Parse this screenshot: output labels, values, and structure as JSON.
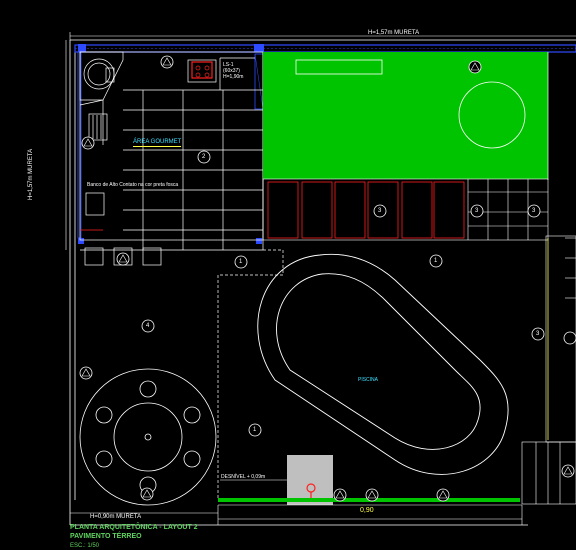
{
  "drawing": {
    "top_dimension": "H=1,57m  MURETA",
    "left_dimension": "H=1,57m  MURETA",
    "bottom_dimension": "H=0,90m  MURETA",
    "bottom_scale_text": "0,90",
    "level_note": "DESNÍVEL + 0,09m",
    "pool_label": "PISCINA",
    "bbq_label": "ÁREA GOURMET",
    "kitchen_tags": [
      "LS-1",
      "(60x37)",
      "H=1,90m"
    ],
    "bench_note": "Banco de Alto Contato na cor preta fosca",
    "callouts_circle": [
      "1",
      "1",
      "1",
      "2",
      "3",
      "3",
      "3",
      "4",
      "3"
    ],
    "callouts_triangle": [
      "7",
      "7",
      "4",
      "7",
      "7",
      "3",
      "3",
      "7",
      "7"
    ],
    "colors": {
      "lawn": "#00c400",
      "wall_blue": "#2f4bff",
      "line": "#ffffff",
      "red": "#ff2020",
      "title_green": "#5fd35f",
      "dim_yellow": "#ffff40",
      "cyan": "#40e0ff"
    }
  },
  "title_block": {
    "line1": "PLANTA ARQUITETÔNICA - LAYOUT 2",
    "line2": "PAVIMENTO TÉRREO",
    "line3": "ESC.: 1/50"
  }
}
